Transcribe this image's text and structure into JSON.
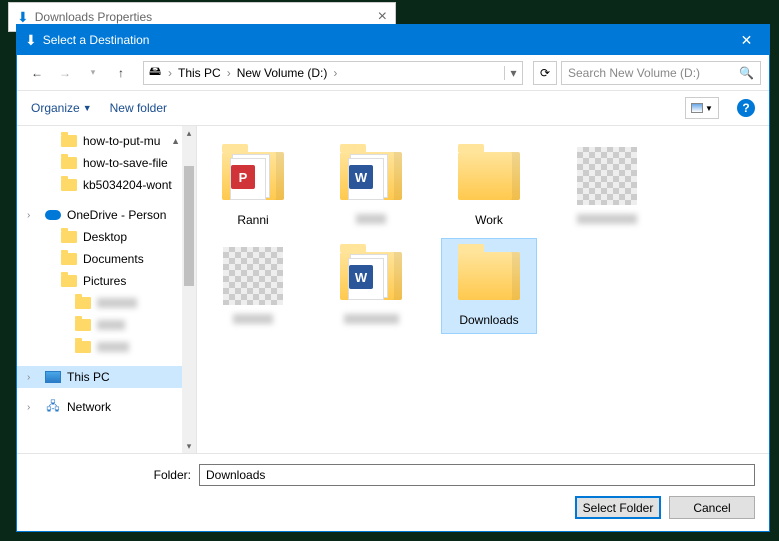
{
  "bgWindow": {
    "title": "Downloads Properties"
  },
  "dialog": {
    "title": "Select a Destination"
  },
  "breadcrumb": {
    "root": "This PC",
    "drive": "New Volume (D:)"
  },
  "search": {
    "placeholder": "Search New Volume (D:)"
  },
  "toolbar": {
    "organize": "Organize",
    "newFolder": "New folder"
  },
  "sidebar": {
    "items": [
      {
        "label": "how-to-put-mu"
      },
      {
        "label": "how-to-save-file"
      },
      {
        "label": "kb5034204-wont"
      }
    ],
    "onedrive": "OneDrive - Person",
    "onedriveChildren": [
      "Desktop",
      "Documents",
      "Pictures"
    ],
    "thisPC": "This PC",
    "network": "Network"
  },
  "items": [
    {
      "label": "Ranni",
      "kind": "pdf"
    },
    {
      "label": "",
      "kind": "word",
      "blurred": true
    },
    {
      "label": "Work",
      "kind": "folder"
    },
    {
      "label": "",
      "kind": "pixelated"
    },
    {
      "label": "",
      "kind": "pixelated"
    },
    {
      "label": "",
      "kind": "word",
      "blurred": true
    },
    {
      "label": "Downloads",
      "kind": "folder",
      "selected": true
    }
  ],
  "footer": {
    "folderLabel": "Folder:",
    "folderValue": "Downloads",
    "selectFolder": "Select Folder",
    "cancel": "Cancel"
  }
}
